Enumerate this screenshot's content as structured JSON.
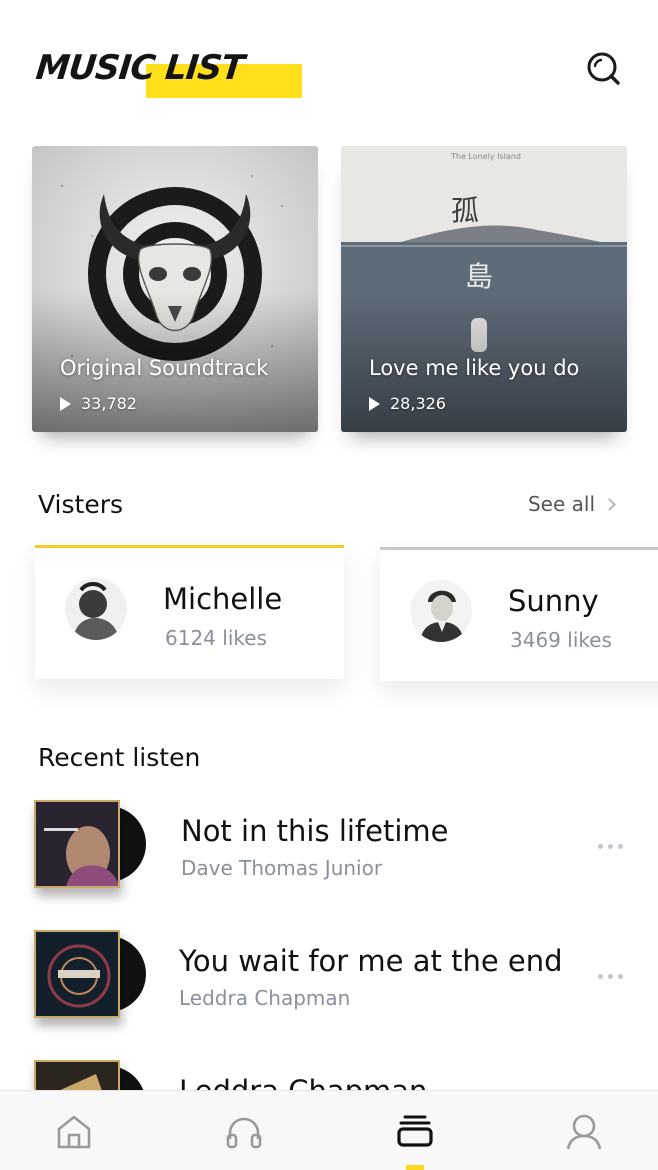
{
  "header": {
    "logo_text": "MUSIC LIST",
    "logo_highlight_color": "#ffe01b",
    "search_icon": "search-icon"
  },
  "albums": [
    {
      "title": "Original Soundtrack",
      "plays": "33,782"
    },
    {
      "title": "Love me like you do",
      "plays": "28,326",
      "cover_caption": "The Lonely Island"
    }
  ],
  "visitors_section": {
    "title": "Visters",
    "see_all": "See all",
    "items": [
      {
        "name": "Michelle",
        "likes": "6124 likes",
        "accent": "#f4cb2b"
      },
      {
        "name": "Sunny",
        "likes": "3469 likes",
        "accent": "#c8c8c8"
      }
    ]
  },
  "recent_section": {
    "title": "Recent listen",
    "tracks": [
      {
        "title": "Not in this lifetime",
        "artist": "Dave Thomas Junior"
      },
      {
        "title": "You wait for me at the end",
        "artist": "Leddra Chapman"
      },
      {
        "title": "Leddra Chapman",
        "artist": ""
      }
    ]
  },
  "bottom_nav": {
    "items": [
      "home-icon",
      "headphones-icon",
      "playlist-icon",
      "profile-icon"
    ],
    "active": "playlist-icon",
    "active_color": "#ffd71e"
  }
}
